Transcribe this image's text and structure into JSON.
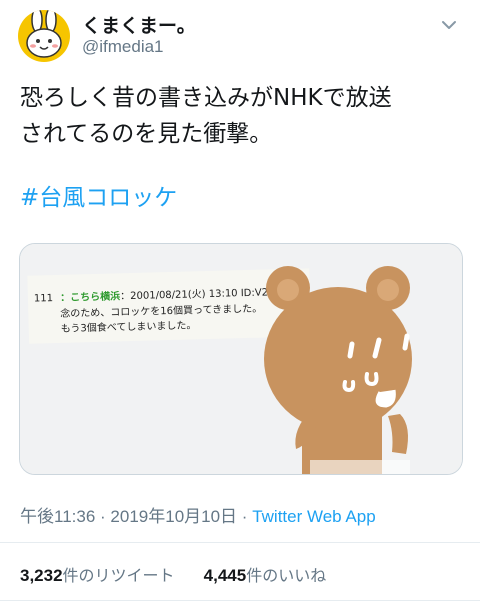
{
  "user": {
    "display_name": "くまくまー。",
    "handle": "@ifmedia1",
    "avatar_icon": "rabbit-face-icon"
  },
  "tweet": {
    "lines": [
      "恐ろしく昔の書き込みがNHKで放送",
      "されてるのを見た衝撃。"
    ],
    "hashtag": "#台風コロッケ"
  },
  "media": {
    "post_number": "111",
    "post_name": "こちら横浜",
    "post_header": "2001/08/21(火) 13:10 ID:V2igkNiA",
    "post_line1": "念のため、コロッケを16個買ってきました。",
    "post_line2": "もう3個食べてしまいました。"
  },
  "meta": {
    "time": "午後11:36",
    "separator": "·",
    "date": "2019年10月10日",
    "source": "Twitter Web App"
  },
  "stats": {
    "retweets_count": "3,232",
    "retweets_label": "件のリツイート",
    "likes_count": "4,445",
    "likes_label": "件のいいね"
  },
  "colors": {
    "accent": "#1da1f2",
    "muted": "#657786",
    "avatar_bg": "#f6c500",
    "bear": "#c8935f",
    "post_name_green": "#2e9a2e"
  }
}
